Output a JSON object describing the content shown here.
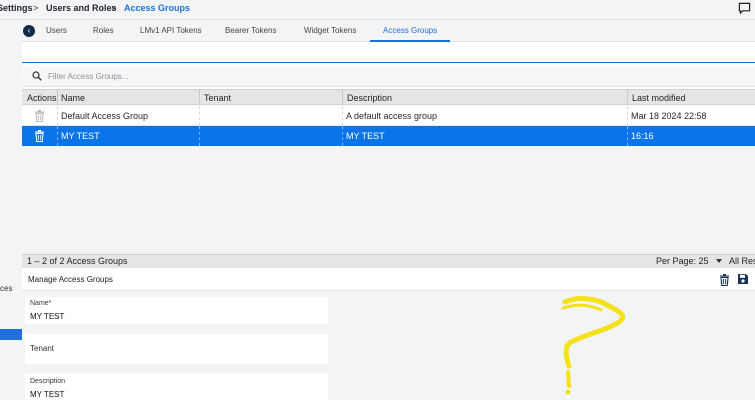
{
  "breadcrumb": {
    "settings": "Settings",
    "users_roles": "Users and Roles",
    "current": "Access Groups",
    "separator": ">"
  },
  "tabs": [
    "Users",
    "Roles",
    "LMv1 API Tokens",
    "Bearer Tokens",
    "Widget Tokens",
    "Access Groups"
  ],
  "back_icon": "‹",
  "filter": {
    "placeholder": "Filter Access Groups..."
  },
  "table": {
    "headers": [
      "Actions",
      "Name",
      "Tenant",
      "Description",
      "Last modified"
    ],
    "rows": [
      {
        "name": "Default Access Group",
        "tenant": "",
        "description": "A default access group",
        "modified": "Mar 18 2024 22:58"
      },
      {
        "name": "MY TEST",
        "tenant": "",
        "description": "MY TEST",
        "modified": "16:16"
      }
    ]
  },
  "footer": {
    "count": "1 – 2 of 2 Access Groups",
    "per_page": "Per Page: 25",
    "all_results": "All Res"
  },
  "leftnav": {
    "item": "ces"
  },
  "manage": {
    "title": "Manage Access Groups"
  },
  "form": {
    "name_label": "Name*",
    "name_value": "MY TEST",
    "tenant_label": "Tenant",
    "description_label": "Description",
    "description_value": "MY TEST"
  },
  "colors": {
    "accent": "#1e6fd9",
    "selected_row": "#0a74e8",
    "annotation": "#f5e11a"
  },
  "icons": [
    "chat-icon",
    "back-icon",
    "search-icon",
    "trash-icon",
    "save-icon",
    "caret-down-icon"
  ]
}
